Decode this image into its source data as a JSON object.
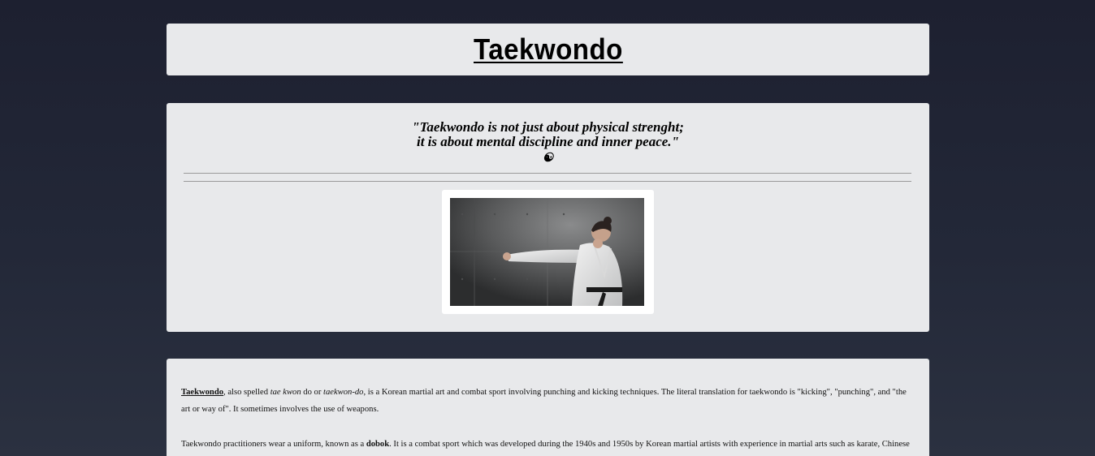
{
  "header": {
    "title": "Taekwondo"
  },
  "quote": {
    "line1": "\"Taekwondo is not just about physical strenght;",
    "line2": "it is about mental discipline and inner peace.\"",
    "icon_glyph": "☯",
    "icon_name": "yin-yang-icon"
  },
  "photo": {
    "alt": "Taekwondo practitioner punching in white dobok with black belt"
  },
  "article": {
    "p1": {
      "term": "Taekwondo",
      "t1": ", also spelled ",
      "alt1": "tae kwon",
      "t2": " do or ",
      "alt2": "taekwon-do",
      "t3": ", is a Korean martial art and combat sport involving punching and kicking techniques. The literal translation for taekwondo is \"kicking\", \"punching\", and \"the art or way of\". It sometimes involves the use of weapons."
    },
    "p2": {
      "t1": "Taekwondo practitioners wear a uniform, known as a ",
      "bold": "dobok",
      "t2": ". It is a combat sport which was developed during the 1940s and 1950s by Korean martial artists with experience in martial arts such as karate, Chinese"
    }
  }
}
